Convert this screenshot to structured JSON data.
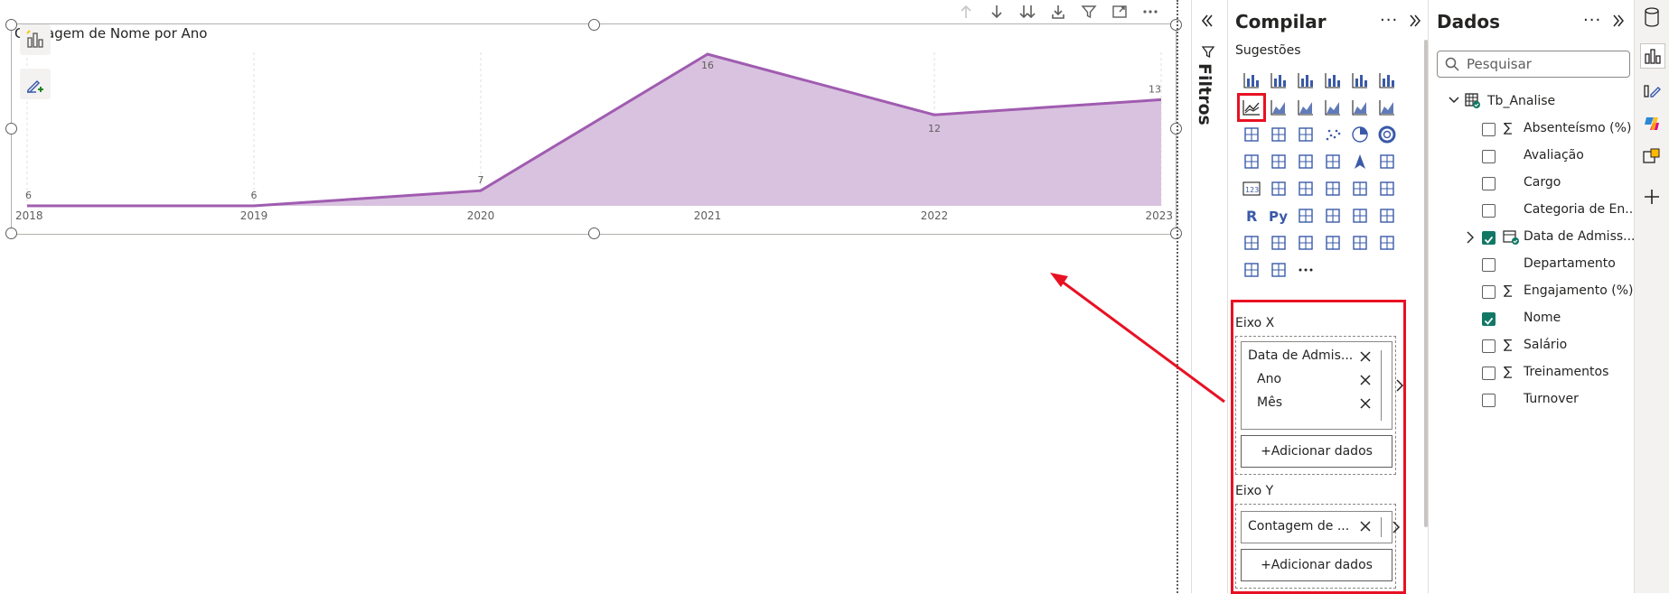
{
  "chart": {
    "title": "Contagem de Nome por Ano"
  },
  "chart_data": {
    "type": "area",
    "title": "Contagem de Nome por Ano",
    "x": [
      "2018",
      "2019",
      "2020",
      "2021",
      "2022",
      "2023"
    ],
    "series": [
      {
        "values": [
          6,
          6,
          7,
          16,
          12,
          13
        ]
      }
    ],
    "ylim": [
      6,
      16
    ],
    "grid": true,
    "colors": {
      "fill": "#d9c2df",
      "line": "#a05cb0"
    }
  },
  "build": {
    "title": "Compilar",
    "suggestions_label": "Sugestões",
    "filters_label": "Filtros",
    "x_axis_label": "Eixo X",
    "y_axis_label": "Eixo Y",
    "x_fields": [
      "Data de Admis...",
      "Ano",
      "Mês"
    ],
    "y_fields": [
      "Contagem de ..."
    ],
    "add_data_label": "+Adicionar dados",
    "more_indicator": "···"
  },
  "data_pane": {
    "title": "Dados",
    "search_placeholder": "Pesquisar",
    "table_name": "Tb_Analise",
    "fields": [
      {
        "name": "Absenteísmo (%)",
        "sigma": true,
        "checked": false
      },
      {
        "name": "Avaliação",
        "sigma": false,
        "checked": false
      },
      {
        "name": "Cargo",
        "sigma": false,
        "checked": false
      },
      {
        "name": "Categoria de En...",
        "sigma": false,
        "checked": false
      },
      {
        "name": "Data de Admiss...",
        "sigma": false,
        "checked": true,
        "hierarchy": true
      },
      {
        "name": "Departamento",
        "sigma": false,
        "checked": false
      },
      {
        "name": "Engajamento (%)",
        "sigma": true,
        "checked": false
      },
      {
        "name": "Nome",
        "sigma": false,
        "checked": true
      },
      {
        "name": "Salário",
        "sigma": true,
        "checked": false
      },
      {
        "name": "Treinamentos",
        "sigma": true,
        "checked": false
      },
      {
        "name": "Turnover",
        "sigma": false,
        "checked": false
      }
    ]
  },
  "colors": {
    "accent_red": "#e81123",
    "check_green": "#117865"
  }
}
